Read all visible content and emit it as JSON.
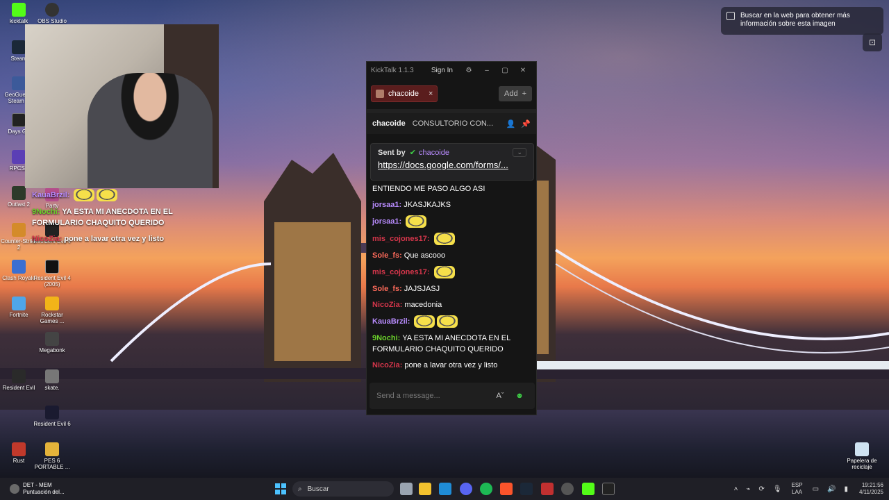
{
  "desktop": {
    "icons": [
      {
        "label": "kicktalk"
      },
      {
        "label": "OBS Studio"
      },
      {
        "label": "Steam"
      },
      {
        "label": "GeoGuessr Steam E"
      },
      {
        "label": "Days Go"
      },
      {
        "label": "RPCS3"
      },
      {
        "label": "Outlast 2"
      },
      {
        "label": "Party"
      },
      {
        "label": "Counter-Strike 2"
      },
      {
        "label": "Resident Evil 4"
      },
      {
        "label": "Clash Royale"
      },
      {
        "label": "Resident Evil 4 (2005)"
      },
      {
        "label": "Fortnite"
      },
      {
        "label": "Rockstar Games ..."
      },
      {
        "label": "Megabonk"
      },
      {
        "label": "Resident Evil"
      },
      {
        "label": "skate."
      },
      {
        "label": "Resident Evil 6"
      },
      {
        "label": "Rust"
      },
      {
        "label": "PES 6 PORTABLE ..."
      },
      {
        "label": "Papelera de reciclaje"
      }
    ]
  },
  "overlay_chat": [
    {
      "user": "KauaBrzil:",
      "text": "",
      "color": "#b98cff",
      "emotes": 2
    },
    {
      "user": "9Nochi:",
      "text": "YA ESTA MI ANECDOTA EN EL FORMULARIO CHAQUITO QUERIDO",
      "color": "#6bd12b",
      "emotes": 0
    },
    {
      "user": "NicoZia:",
      "text": "pone a lavar otra vez y listo",
      "color": "#d6364b",
      "emotes": 0
    }
  ],
  "kicktalk": {
    "title": "KickTalk 1.1.3",
    "sign_in": "Sign In",
    "tab_label": "chacoide",
    "add_label": "Add",
    "channel_name": "chacoide",
    "stream_title": "CONSULTORIO CON...",
    "pinned": {
      "sent_by": "Sent by",
      "sender": "chacoide",
      "link": "https://docs.google.com/forms/..."
    },
    "messages": [
      {
        "user": "",
        "text": "ENTIENDO ME PASO ALGO ASI",
        "color": "#fff",
        "emotes": 0
      },
      {
        "user": "jorsaa1:",
        "text": "JKASJKAJKS",
        "color": "#b98cff",
        "emotes": 0
      },
      {
        "user": "jorsaa1:",
        "text": "",
        "color": "#b98cff",
        "emotes": 1
      },
      {
        "user": "mis_cojones17:",
        "text": "",
        "color": "#d6364b",
        "emotes": 1
      },
      {
        "user": "Sole_fs:",
        "text": "Que ascooo",
        "color": "#ff6b5b",
        "emotes": 0
      },
      {
        "user": "mis_cojones17:",
        "text": "",
        "color": "#d6364b",
        "emotes": 1
      },
      {
        "user": "Sole_fs:",
        "text": "JAJSJASJ",
        "color": "#ff6b5b",
        "emotes": 0
      },
      {
        "user": "NicoZia:",
        "text": "macedonia",
        "color": "#d6364b",
        "emotes": 0
      },
      {
        "user": "KauaBrzil:",
        "text": "",
        "color": "#b98cff",
        "emotes": 2
      },
      {
        "user": "9Nochi:",
        "text": "YA ESTA MI ANECDOTA EN EL FORMULARIO CHAQUITO QUERIDO",
        "color": "#6bd12b",
        "emotes": 0
      },
      {
        "user": "NicoZia:",
        "text": "pone a lavar otra vez y listo",
        "color": "#d6364b",
        "emotes": 0
      }
    ],
    "input_placeholder": "Send a message..."
  },
  "visual_search": {
    "text": "Buscar en la web para obtener más información sobre esta imagen"
  },
  "taskbar": {
    "weather_title": "DET - MEM",
    "weather_sub": "Puntuación del...",
    "search_placeholder": "Buscar",
    "lang_top": "ESP",
    "lang_bottom": "LAA",
    "time": "19:21:56",
    "date": "4/11/2025"
  },
  "colors": {
    "kick_green": "#53fc18",
    "tab_red": "#5a1d1d"
  }
}
